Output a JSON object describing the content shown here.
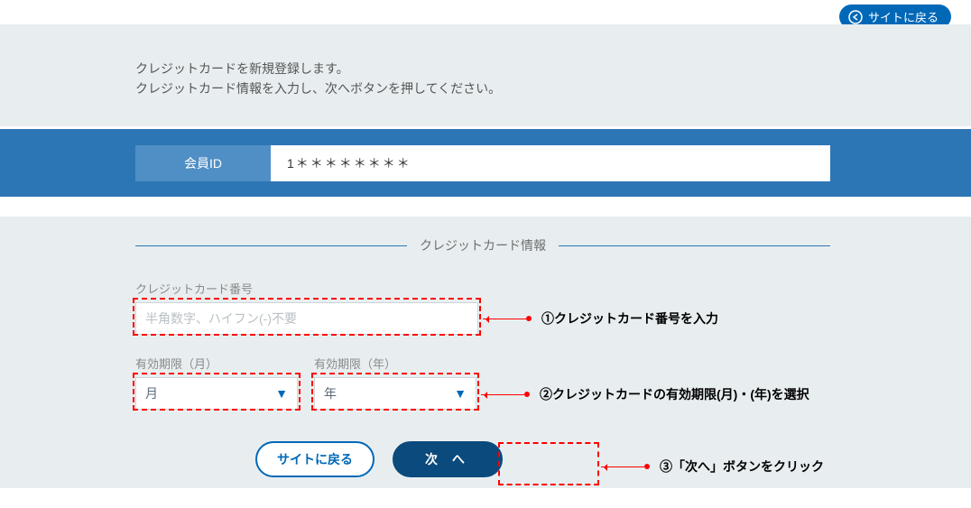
{
  "topButton": {
    "label": "サイトに戻る"
  },
  "description": {
    "line1": "クレジットカードを新規登録します。",
    "line2": "クレジットカード情報を入力し、次へボタンを押してください。"
  },
  "memberId": {
    "label": "会員ID",
    "value": "1＊＊＊＊＊＊＊＊"
  },
  "section": {
    "title": "クレジットカード情報"
  },
  "cardNumber": {
    "label": "クレジットカード番号",
    "placeholder": "半角数字、ハイフン(-)不要"
  },
  "expiry": {
    "monthLabel": "有効期限（月）",
    "monthValue": "月",
    "yearLabel": "有効期限（年）",
    "yearValue": "年"
  },
  "buttons": {
    "back": "サイトに戻る",
    "next": "次 へ"
  },
  "annotations": {
    "a1": "①クレジットカード番号を入力",
    "a2": "②クレジットカードの有効期限(月)・(年)を選択",
    "a3": "③「次へ」ボタンをクリック"
  }
}
